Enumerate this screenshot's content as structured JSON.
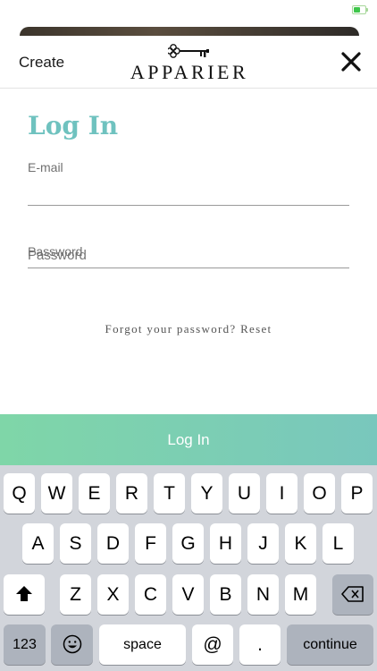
{
  "header": {
    "create_label": "Create",
    "brand": "APPARIER",
    "close_icon": "close-icon",
    "key_icon": "key-logo-icon"
  },
  "form": {
    "title": "Log In",
    "email_label": "E-mail",
    "email_value": "",
    "password_label": "Password",
    "password_value": "",
    "forgot_text": "Forgot your password?",
    "reset_label": "Reset",
    "submit_label": "Log In"
  },
  "keyboard": {
    "row1": [
      "Q",
      "W",
      "E",
      "R",
      "T",
      "Y",
      "U",
      "I",
      "O",
      "P"
    ],
    "row2": [
      "A",
      "S",
      "D",
      "F",
      "G",
      "H",
      "J",
      "K",
      "L"
    ],
    "row3": [
      "Z",
      "X",
      "C",
      "V",
      "B",
      "N",
      "M"
    ],
    "numbers_label": "123",
    "space_label": "space",
    "at_label": "@",
    "period_label": ".",
    "continue_label": "continue",
    "shift_icon": "shift-icon",
    "delete_icon": "delete-icon",
    "emoji_icon": "emoji-icon"
  },
  "colors": {
    "accent": "#6fc2bf",
    "button_gradient_start": "#7fd6a8",
    "button_gradient_end": "#79c7bd",
    "battery": "#3ec64b"
  }
}
